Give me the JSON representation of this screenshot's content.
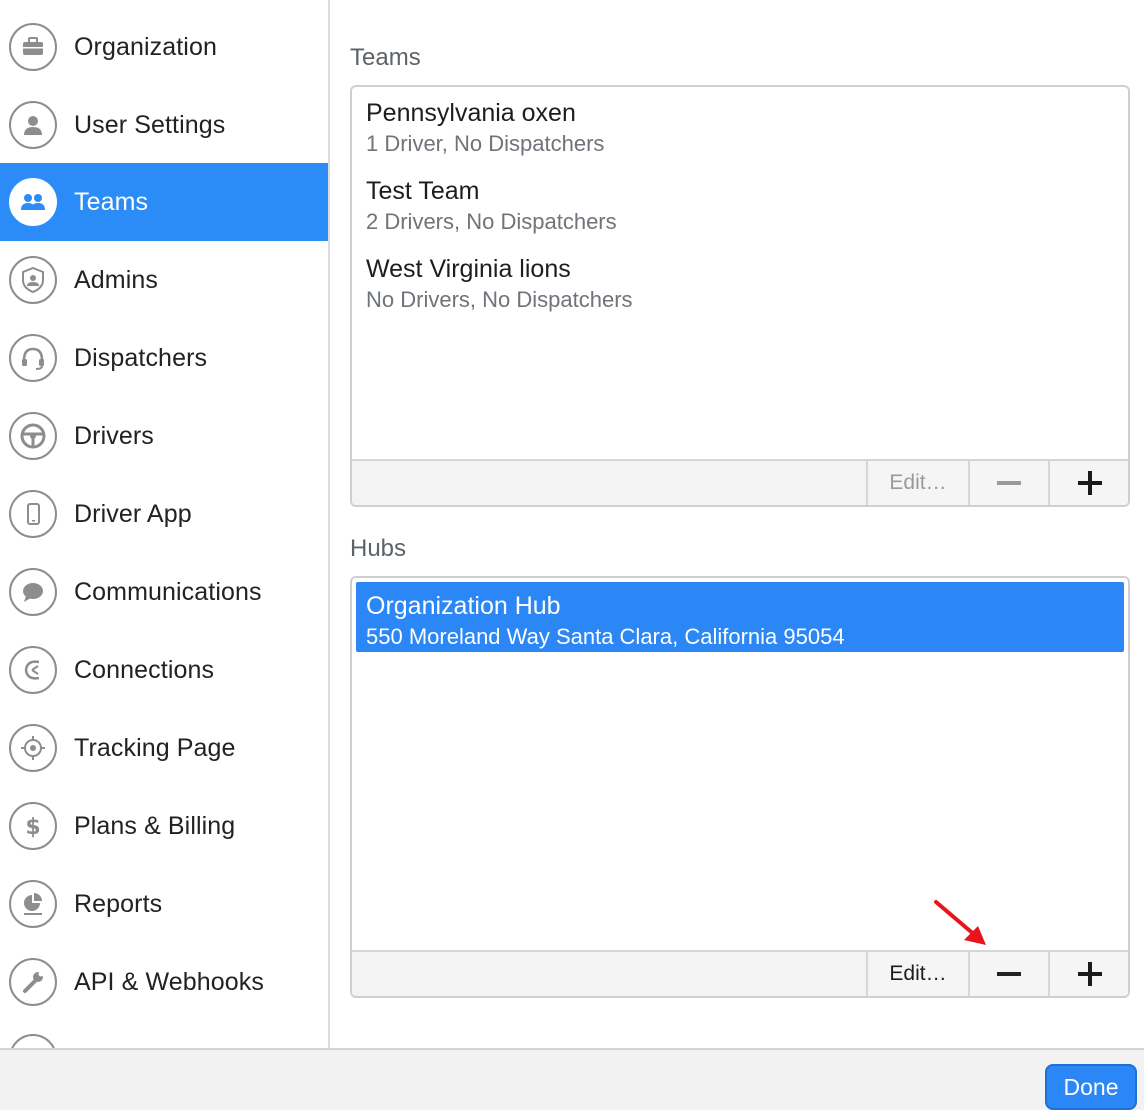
{
  "sidebar": {
    "items": [
      {
        "label": "Organization",
        "icon": "briefcase-icon"
      },
      {
        "label": "User Settings",
        "icon": "user-icon"
      },
      {
        "label": "Teams",
        "icon": "team-icon"
      },
      {
        "label": "Admins",
        "icon": "shield-user-icon"
      },
      {
        "label": "Dispatchers",
        "icon": "headset-icon"
      },
      {
        "label": "Drivers",
        "icon": "steering-wheel-icon"
      },
      {
        "label": "Driver App",
        "icon": "phone-icon"
      },
      {
        "label": "Communications",
        "icon": "chat-bubble-icon"
      },
      {
        "label": "Connections",
        "icon": "connections-icon"
      },
      {
        "label": "Tracking Page",
        "icon": "crosshair-icon"
      },
      {
        "label": "Plans & Billing",
        "icon": "dollar-icon"
      },
      {
        "label": "Reports",
        "icon": "pie-chart-icon"
      },
      {
        "label": "API & Webhooks",
        "icon": "wrench-icon"
      }
    ],
    "active": "Teams"
  },
  "teams": {
    "heading": "Teams",
    "items": [
      {
        "name": "Pennsylvania oxen",
        "summary": "1 Driver, No Dispatchers"
      },
      {
        "name": "Test Team",
        "summary": "2 Drivers, No Dispatchers"
      },
      {
        "name": "West Virginia lions",
        "summary": "No Drivers, No Dispatchers"
      }
    ],
    "edit_label": "Edit…"
  },
  "hubs": {
    "heading": "Hubs",
    "items": [
      {
        "name": "Organization Hub",
        "address": "550 Moreland Way Santa Clara, California 95054",
        "selected": true
      }
    ],
    "edit_label": "Edit…"
  },
  "footer": {
    "done_label": "Done"
  },
  "colors": {
    "accent": "#2b86f6",
    "annotation_arrow": "#e8141b"
  }
}
